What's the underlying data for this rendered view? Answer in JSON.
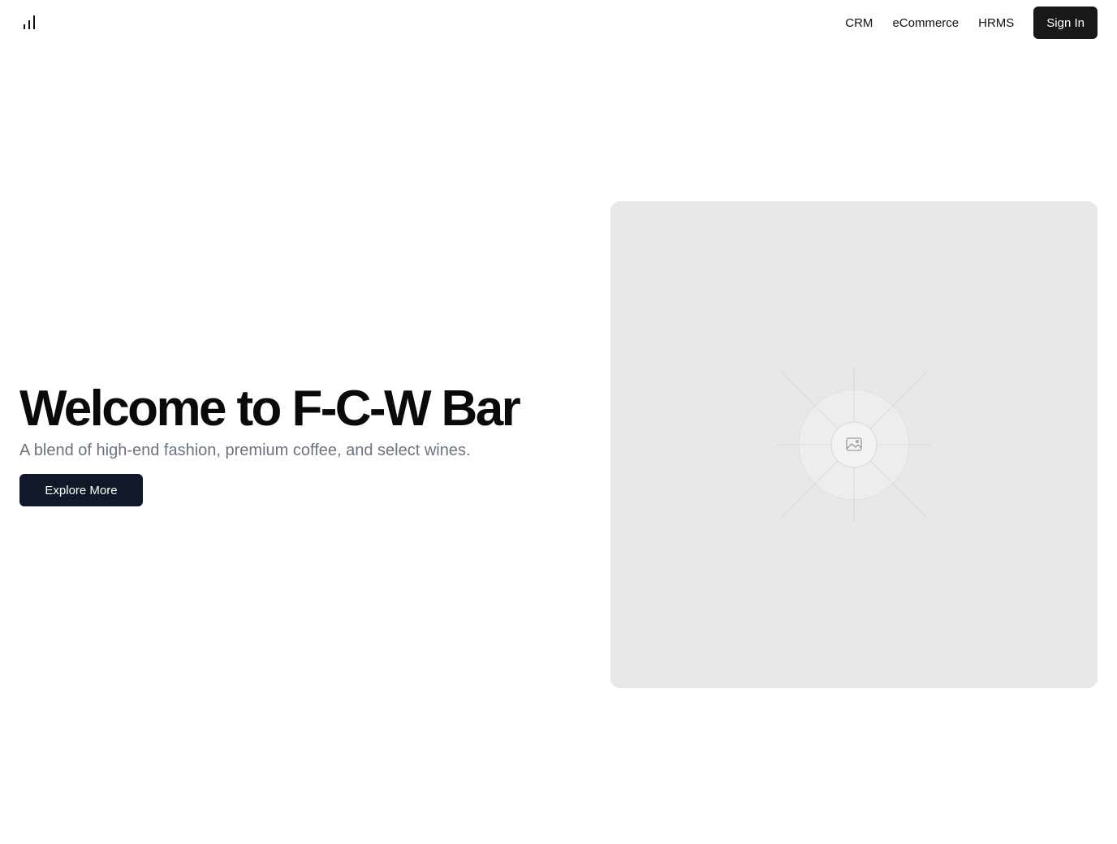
{
  "header": {
    "logo_icon": "bar-chart-icon",
    "nav": [
      {
        "label": "CRM"
      },
      {
        "label": "eCommerce"
      },
      {
        "label": "HRMS"
      }
    ],
    "signin_label": "Sign In"
  },
  "hero": {
    "title": "Welcome to F-C-W Bar",
    "subtitle": "A blend of high-end fashion, premium coffee, and select wines.",
    "cta_label": "Explore More"
  },
  "media": {
    "icon": "image-placeholder-icon"
  },
  "colors": {
    "primary_button": "#111827",
    "signin_button": "#18181b",
    "subtitle": "#6b7280",
    "placeholder_bg": "#e8e8e8"
  }
}
